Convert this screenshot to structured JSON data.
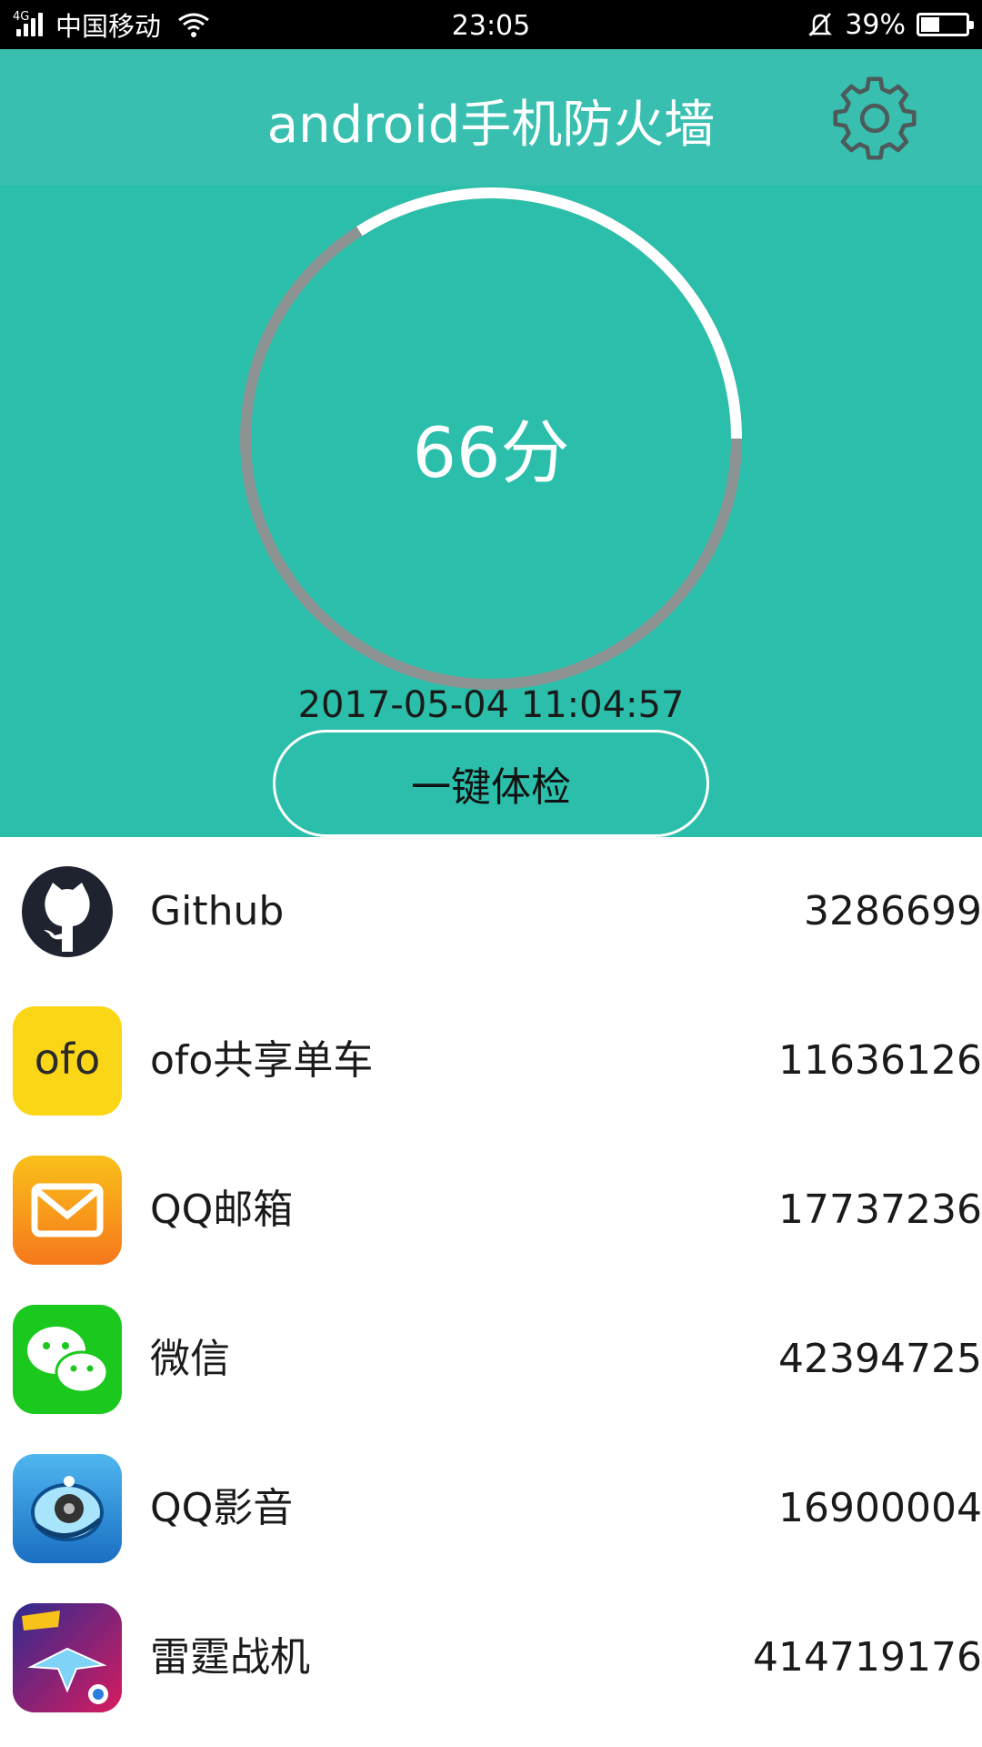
{
  "status_bar": {
    "network": "4G",
    "carrier": "中国移动",
    "time": "23:05",
    "battery_percent_text": "39%",
    "battery_level": 0.39
  },
  "header": {
    "title": "android手机防火墙",
    "settings_icon": "gear-icon"
  },
  "hero": {
    "score_text": "66分",
    "score_progress": 0.66,
    "last_check_time": "2017-05-04 11:04:57",
    "check_button_label": "一键体检",
    "colors": {
      "background": "#2bbfab",
      "header": "#38bfb0",
      "ring_filled": "#ffffff",
      "ring_track": "#8c9292"
    }
  },
  "apps": [
    {
      "name": "Github",
      "value": "3286699",
      "icon": "github-icon"
    },
    {
      "name": "ofo共享单车",
      "value": "11636126",
      "icon": "ofo-icon"
    },
    {
      "name": "QQ邮箱",
      "value": "17737236",
      "icon": "qq-mail-icon"
    },
    {
      "name": "微信",
      "value": "42394725",
      "icon": "wechat-icon"
    },
    {
      "name": "QQ影音",
      "value": "16900004",
      "icon": "qq-player-icon"
    },
    {
      "name": "雷霆战机",
      "value": "414719176",
      "icon": "thunder-fighter-icon"
    }
  ]
}
